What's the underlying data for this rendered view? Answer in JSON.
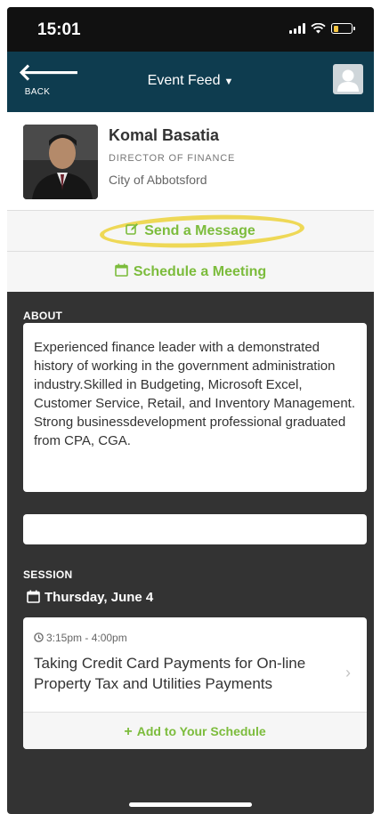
{
  "status_bar": {
    "time": "15:01"
  },
  "nav": {
    "back_label": "BACK",
    "title": "Event Feed"
  },
  "profile": {
    "name": "Komal Basatia",
    "role": "DIRECTOR OF FINANCE",
    "organization": "City of Abbotsford"
  },
  "actions": {
    "send_message": "Send a Message",
    "schedule_meeting": "Schedule a Meeting"
  },
  "about": {
    "label": "ABOUT",
    "text": "Experienced finance leader with a demonstrated history of working in the government administration industry.Skilled in Budgeting, Microsoft Excel, Customer Service, Retail, and Inventory Management. Strong businessdevelopment professional graduated from CPA, CGA."
  },
  "session": {
    "label": "SESSION",
    "date": "Thursday, June 4",
    "time": "3:15pm - 4:00pm",
    "title": "Taking Credit Card Payments for On-line Property Tax and Utilities Payments",
    "add_label": "Add to Your Schedule"
  },
  "colors": {
    "nav_background": "#0e3c4f",
    "accent_green": "#7cbc3c",
    "page_background": "#333333",
    "highlight_yellow": "#ecd23a"
  },
  "icons": {
    "back": "arrow-left-icon",
    "message": "edit-icon",
    "meeting": "calendar-icon",
    "time": "clock-icon",
    "chevron": "chevron-right-icon",
    "add": "plus-icon"
  }
}
